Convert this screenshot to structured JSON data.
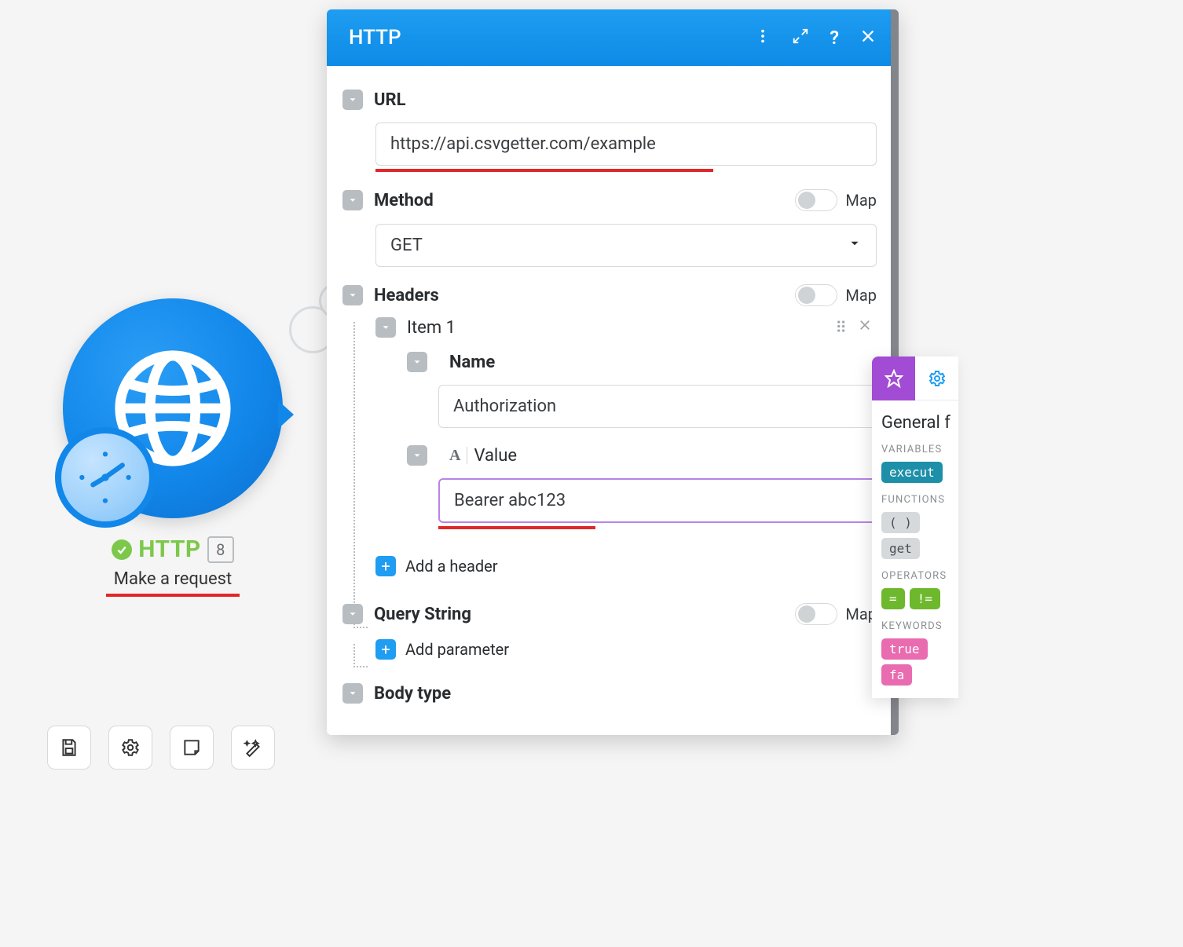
{
  "node": {
    "name": "HTTP",
    "subtitle": "Make a request",
    "count": "8"
  },
  "panel": {
    "title": "HTTP",
    "url_label": "URL",
    "url_value": "https://api.csvgetter.com/example",
    "method_label": "Method",
    "method_value": "GET",
    "map_label": "Map",
    "headers_label": "Headers",
    "item1_label": "Item 1",
    "name_label": "Name",
    "name_value": "Authorization",
    "value_label": "Value",
    "value_value": "Bearer abc123",
    "add_header": "Add a header",
    "query_label": "Query String",
    "add_param": "Add parameter",
    "body_label": "Body type"
  },
  "helper": {
    "title": "General f",
    "cat_variables": "VARIABLES",
    "var1": "execut",
    "cat_functions": "FUNCTIONS",
    "fn_paren": "( )",
    "fn_get": "get",
    "cat_operators": "OPERATORS",
    "op_eq": "=",
    "op_neq": "!=",
    "cat_keywords": "KEYWORDS",
    "kw_true": "true",
    "kw_fa": "fa"
  }
}
